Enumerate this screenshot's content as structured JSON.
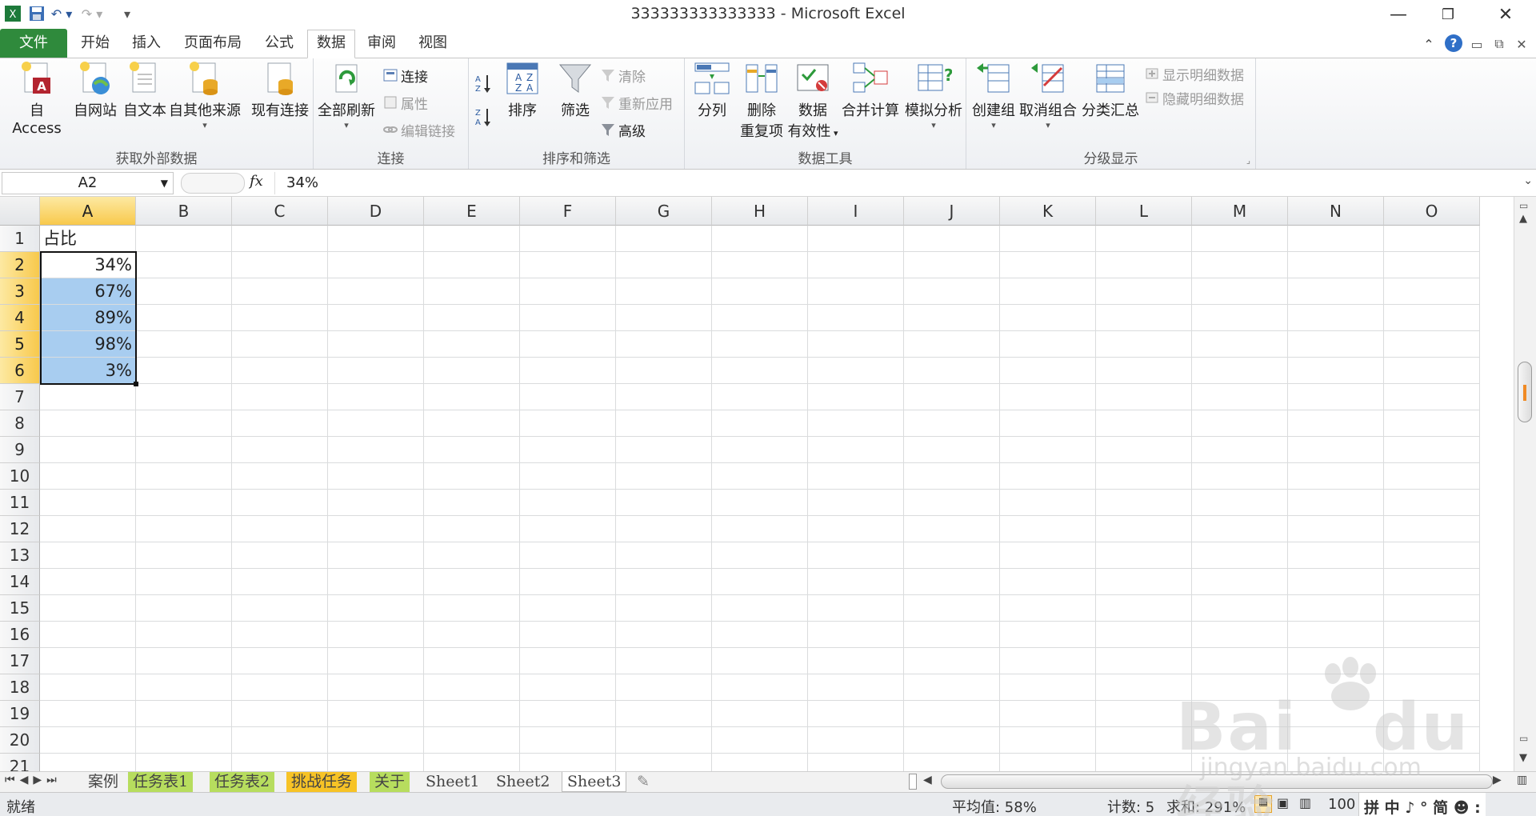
{
  "window": {
    "title": "333333333333333 - Microsoft Excel"
  },
  "quick_access": [
    "save-icon",
    "undo-icon",
    "redo-icon"
  ],
  "tabs": [
    {
      "label": "文件"
    },
    {
      "label": "开始"
    },
    {
      "label": "插入"
    },
    {
      "label": "页面布局"
    },
    {
      "label": "公式"
    },
    {
      "label": "数据"
    },
    {
      "label": "审阅"
    },
    {
      "label": "视图"
    }
  ],
  "ribbon": {
    "groups": {
      "external": "获取外部数据",
      "connections": "连接",
      "sortfilter": "排序和筛选",
      "datatools": "数据工具",
      "outline": "分级显示"
    },
    "buttons": {
      "from_access": "自 Access",
      "from_web": "自网站",
      "from_text": "自文本",
      "from_other": "自其他来源",
      "existing": "现有连接",
      "refresh_all": "全部刷新",
      "connections": "连接",
      "properties": "属性",
      "edit_links": "编辑链接",
      "sort": "排序",
      "filter": "筛选",
      "clear": "清除",
      "reapply": "重新应用",
      "advanced": "高级",
      "text_to_columns": "分列",
      "remove_dup_1": "删除",
      "remove_dup_2": "重复项",
      "validation_1": "数据",
      "validation_2": "有效性",
      "consolidate": "合并计算",
      "whatif": "模拟分析",
      "group": "创建组",
      "ungroup": "取消组合",
      "subtotal": "分类汇总",
      "show_detail": "显示明细数据",
      "hide_detail": "隐藏明细数据"
    }
  },
  "formula_bar": {
    "name_box": "A2",
    "fx": "fx",
    "formula": "34%"
  },
  "columns": [
    "A",
    "B",
    "C",
    "D",
    "E",
    "F",
    "G",
    "H",
    "I",
    "J",
    "K",
    "L",
    "M",
    "N",
    "O"
  ],
  "rows": [
    "1",
    "2",
    "3",
    "4",
    "5",
    "6",
    "7",
    "8",
    "9",
    "10",
    "11",
    "12",
    "13",
    "14",
    "15",
    "16",
    "17",
    "18",
    "19",
    "20",
    "21"
  ],
  "cells": {
    "a1": "占比",
    "a2": "34%",
    "a3": "67%",
    "a4": "89%",
    "a5": "98%",
    "a6": "3%"
  },
  "sheets": [
    "案例",
    "任务表1",
    "任务表2",
    "挑战任务",
    "关于",
    "Sheet1",
    "Sheet2",
    "Sheet3"
  ],
  "status": {
    "ready": "就绪",
    "average": "平均值: 58%",
    "count": "计数: 5",
    "sum": "求和: 291%",
    "zoom": "100",
    "ime": "拼 中 ♪ ° 简 ☻ :"
  },
  "watermark": {
    "line1": "Bai",
    "line2": "du",
    "line3": "经验",
    "url": "jingyan.baidu.com"
  }
}
